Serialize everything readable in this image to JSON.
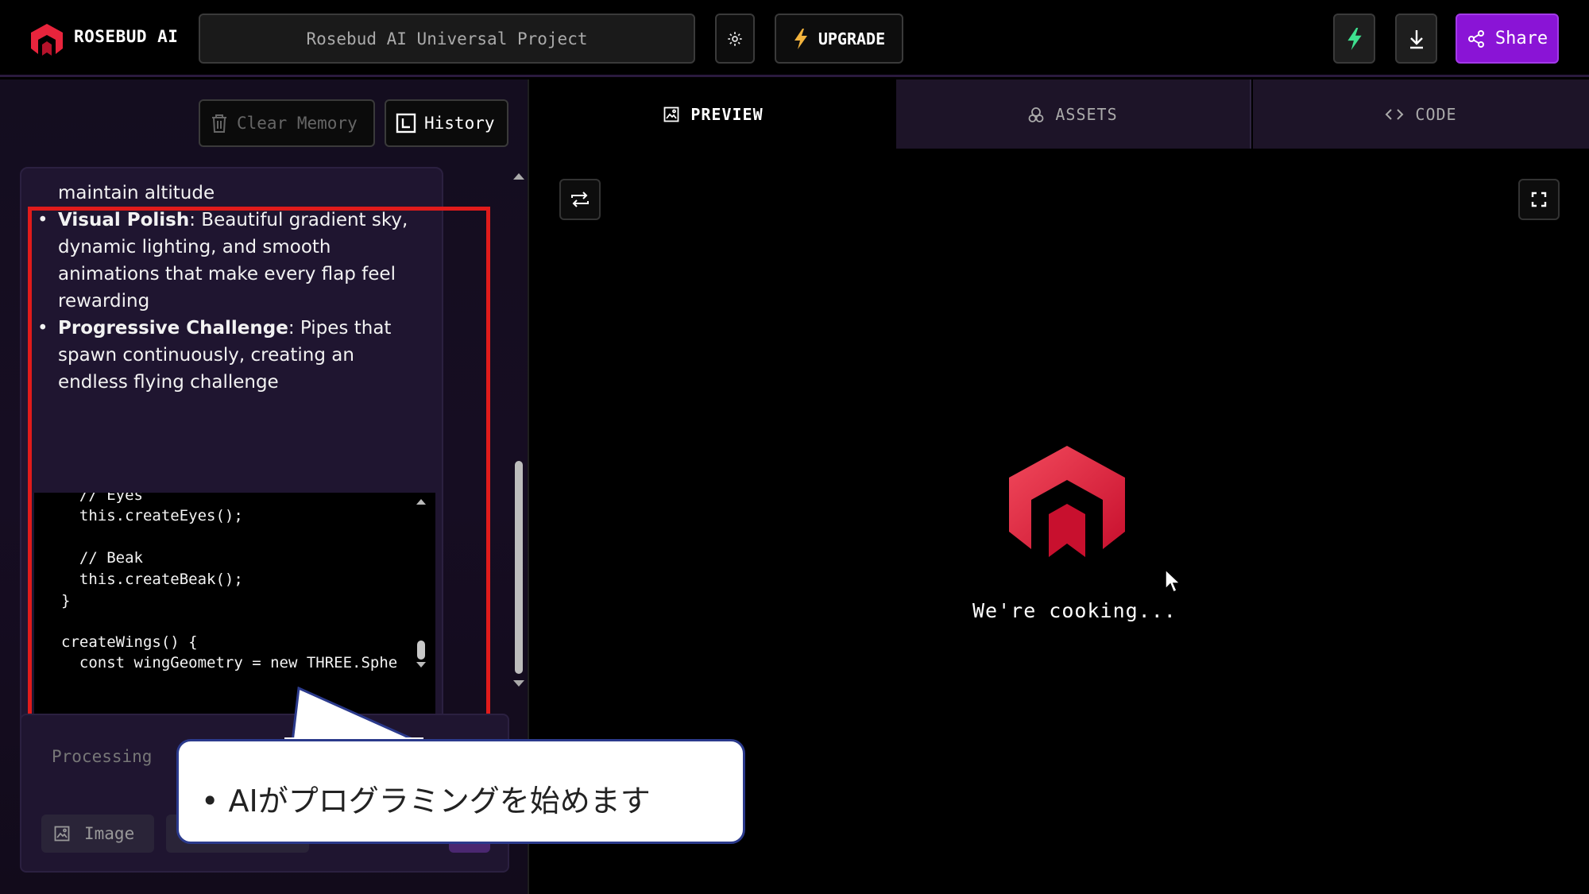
{
  "header": {
    "brand": "ROSEBUD AI",
    "project_name": "Rosebud AI Universal Project",
    "upgrade_label": "UPGRADE",
    "share_label": "Share"
  },
  "left_panel": {
    "clear_memory_label": "Clear Memory",
    "history_label": "History",
    "chat": {
      "line_1": "maintain altitude",
      "bullet_2_title": "Visual Polish",
      "bullet_2_line_1": ": Beautiful gradient sky,",
      "bullet_2_line_2": "dynamic lighting, and smooth",
      "bullet_2_line_3": "animations that make every flap feel",
      "bullet_2_line_4": "rewarding",
      "bullet_3_title": "Progressive Challenge",
      "bullet_3_line_1": ": Pipes that",
      "bullet_3_line_2": "spawn continuously, creating an",
      "bullet_3_line_3": "endless flying challenge",
      "bullet_dot": "•"
    },
    "code_lines": [
      "  // Eyes",
      "  this.createEyes();",
      "",
      "  // Beak",
      "  this.createBeak();",
      "}",
      "",
      "createWings() {",
      "  const wingGeometry = new THREE.Sphe"
    ],
    "input": {
      "placeholder": "Processing",
      "image_label": "Image"
    }
  },
  "tabs": {
    "preview": "PREVIEW",
    "assets": "ASSETS",
    "code": "CODE"
  },
  "preview": {
    "status": "We're cooking..."
  },
  "callout": {
    "text": "• AIがプログラミングを始めます"
  },
  "colors": {
    "accent_purple": "#8a14d6",
    "highlight_red": "#e01b1b",
    "logo_red": "#e8243c",
    "bolt_green": "#3ee08f"
  }
}
